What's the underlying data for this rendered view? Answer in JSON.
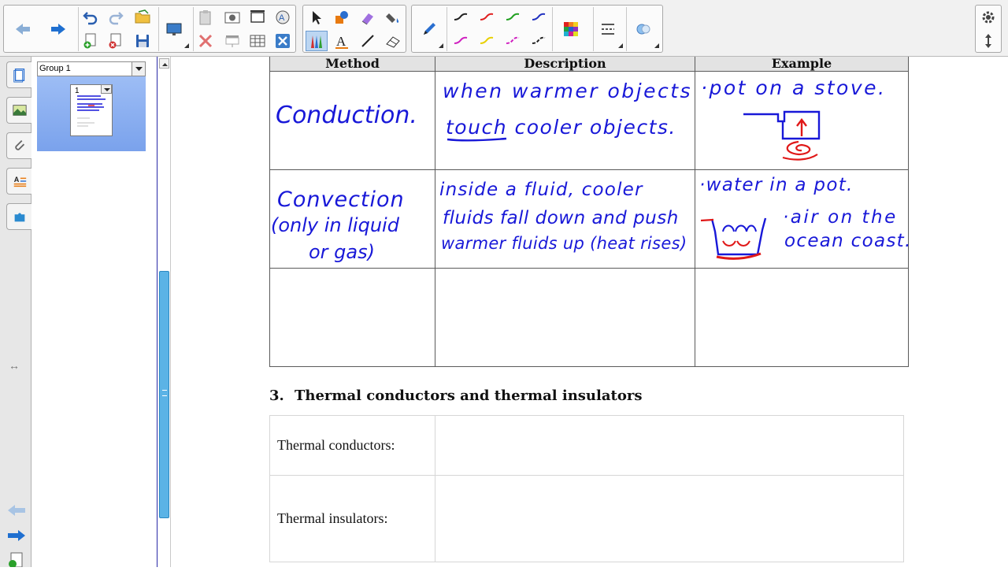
{
  "toolbar": {
    "buttons": {
      "back": "back-arrow-icon",
      "forward": "forward-arrow-icon",
      "undo": "undo-icon",
      "redo": "redo-icon",
      "open": "open-folder-icon",
      "add_page": "add-page-icon",
      "delete_page": "delete-page-icon",
      "save": "save-icon",
      "display": "screen-display-icon",
      "paste": "paste-icon",
      "screen_capture": "camera-icon",
      "full_screen": "full-screen-icon",
      "handwriting": "handwriting-recognition-icon",
      "delete": "delete-x-icon",
      "screen_shade": "screen-shade-icon",
      "table": "table-icon",
      "close_ink": "close-ink-icon",
      "select": "select-arrow-icon",
      "shapes": "shapes-icon",
      "eraser_pen": "magic-pen-icon",
      "fill": "fill-icon",
      "pens": "pens-icon",
      "text": "text-icon",
      "line": "line-icon",
      "eraser": "eraser-icon",
      "pen_tool": "pen-tool-icon",
      "colors": "color-palette-icon",
      "line_style": "line-style-icon",
      "fill_effects": "fill-effects-icon",
      "settings": "gear-icon",
      "move_toolbar": "move-toolbar-icon"
    },
    "pen_colors": [
      "#222222",
      "#e02020",
      "#20a020",
      "#2030c0",
      "#d020c0",
      "#e8d000",
      "#d020c0",
      "#222222"
    ]
  },
  "sidebar": {
    "tabs": [
      "page-sorter-icon",
      "gallery-icon",
      "attachments-icon",
      "properties-icon",
      "add-ons-icon"
    ],
    "group_select": "Group 1",
    "page_number": "1",
    "bottom_nav": [
      "back-arrow-icon",
      "forward-arrow-icon",
      "add-page-icon"
    ]
  },
  "table1": {
    "headers": [
      "Method",
      "Description",
      "Example"
    ],
    "rows": [
      {
        "method": [
          "Conduction."
        ],
        "description": [
          "when warmer objects",
          "touch cooler objects."
        ],
        "example": [
          "·pot on a stove."
        ]
      },
      {
        "method": [
          "Convection",
          "(only in liquid",
          "or gas)"
        ],
        "description": [
          "inside a fluid, cooler",
          "fluids fall down and push",
          "warmer fluids up (heat rises)"
        ],
        "example": [
          "·water in a pot.",
          "·air on the",
          "ocean coast."
        ]
      },
      {
        "method": [],
        "description": [],
        "example": []
      }
    ]
  },
  "section3": {
    "number": "3.",
    "title": "Thermal conductors and thermal insulators",
    "rows": [
      {
        "label": "Thermal conductors:",
        "value": ""
      },
      {
        "label": "Thermal insulators:",
        "value": ""
      }
    ]
  },
  "colors": {
    "ink_blue": "#1818d8",
    "ink_red": "#e01818",
    "scroll_blue": "#5bb3e6",
    "thumb_selected": "#8ab0f0"
  }
}
